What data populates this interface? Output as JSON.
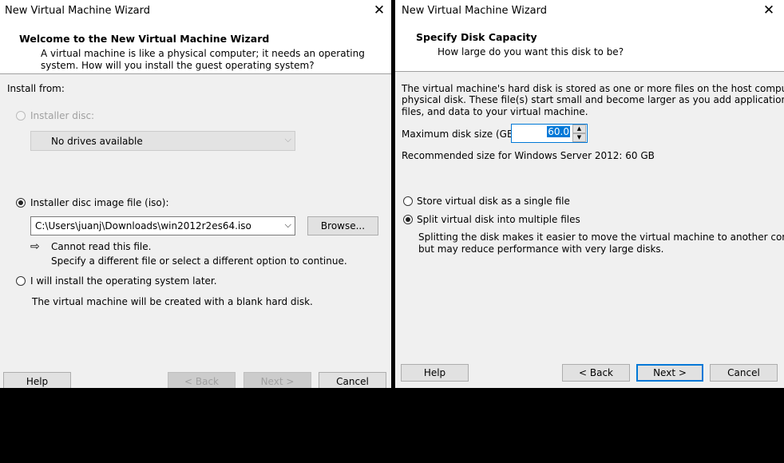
{
  "left": {
    "title": "New Virtual Machine Wizard",
    "header_title": "Welcome to the New Virtual Machine Wizard",
    "header_sub_1": "A virtual machine is like a physical computer; it needs an operating",
    "header_sub_2": "system. How will you install the guest operating system?",
    "install_from": "Install from:",
    "opt_disc": "Installer disc:",
    "disc_combo": "No drives available",
    "opt_iso": "Installer disc image file (iso):",
    "iso_path": "C:\\Users\\juanj\\Downloads\\win2012r2es64.iso",
    "browse": "Browse...",
    "warn_1": "Cannot read this file.",
    "warn_2": "Specify a different file or select a different option to continue.",
    "opt_later": "I will install the operating system later.",
    "later_note": "The virtual machine will be created with a blank hard disk.",
    "help": "Help",
    "back": "< Back",
    "next": "Next >",
    "cancel": "Cancel"
  },
  "right": {
    "title": "New Virtual Machine Wizard",
    "header_title": "Specify Disk Capacity",
    "header_sub": "How large do you want this disk to be?",
    "desc_1": "The virtual machine's hard disk is stored as one or more files on the host computer's",
    "desc_2": "physical disk. These file(s) start small and become larger as you add applications,",
    "desc_3": "files, and data to your virtual machine.",
    "max_size_label": "Maximum disk size (GB):",
    "max_size_value": "60.0",
    "recommended": "Recommended size for Windows Server 2012: 60 GB",
    "opt_single": "Store virtual disk as a single file",
    "opt_split": "Split virtual disk into multiple files",
    "split_note_1": "Splitting the disk makes it easier to move the virtual machine to another computer",
    "split_note_2": "but may reduce performance with very large disks.",
    "help": "Help",
    "back": "< Back",
    "next": "Next >",
    "cancel": "Cancel"
  }
}
